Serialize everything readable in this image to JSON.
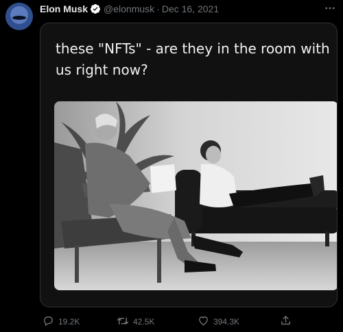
{
  "tweet": {
    "author_name": "Elon Musk",
    "handle": "@elonmusk",
    "separator": "·",
    "date": "Dec 16, 2021",
    "more_icon": "more-horizontal-icon",
    "verified_icon": "verified-badge-icon",
    "verified_color": "#1d9bf0"
  },
  "media": {
    "caption": "these \"NFTs\" - are they in the room with us right now?"
  },
  "actions": {
    "reply_count": "19.2K",
    "retweet_count": "42.5K",
    "like_count": "394.3K",
    "reply_icon": "reply-icon",
    "retweet_icon": "retweet-icon",
    "like_icon": "heart-icon",
    "share_icon": "share-icon"
  }
}
